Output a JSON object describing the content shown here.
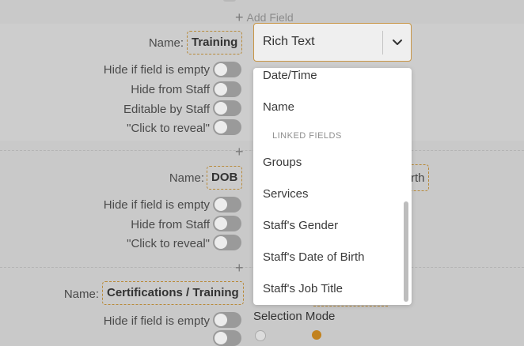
{
  "add_field_label": "Add Field",
  "fields": [
    {
      "name_label": "Name:",
      "name_value": "Training",
      "options": [
        "Hide if field is empty",
        "Hide from Staff",
        "Editable by Staff",
        "\"Click to reveal\""
      ]
    },
    {
      "name_label": "Name:",
      "name_value": "DOB",
      "partial_right_text": "rth",
      "options": [
        "Hide if field is empty",
        "Hide from Staff",
        "\"Click to reveal\""
      ]
    },
    {
      "name_label": "Name:",
      "name_value": "Certifications / Training",
      "options": [
        "Hide if field is empty"
      ],
      "selection_mode_label": "Selection Mode"
    }
  ],
  "field_type_select": {
    "selected": "Rich Text",
    "options_before_group": [
      "Date/Time",
      "Name"
    ],
    "group_label": "LINKED FIELDS",
    "linked_options": [
      "Groups",
      "Services",
      "Staff's Gender",
      "Staff's Date of Birth",
      "Staff's Job Title"
    ]
  },
  "colors": {
    "background": "#c9c9c9",
    "accent_border": "#c89646",
    "radio_selected": "#c2821e"
  }
}
